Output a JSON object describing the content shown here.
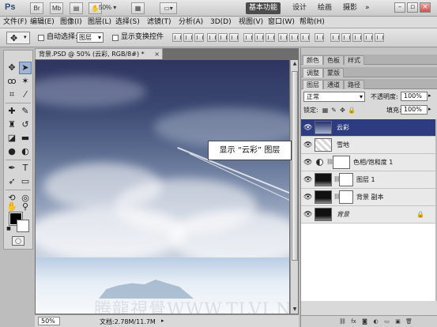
{
  "app": {
    "logo": "Ps",
    "zoom": "50%"
  },
  "topbar": {
    "buttons": [
      "Br",
      "Mb"
    ],
    "zoom_select": "50%",
    "workspaces": [
      {
        "label": "基本功能",
        "active": true
      },
      {
        "label": "设计",
        "active": false
      },
      {
        "label": "绘画",
        "active": false
      },
      {
        "label": "摄影",
        "active": false
      }
    ],
    "window_controls": {
      "minimize": "–",
      "restore": "▫",
      "close": "×"
    }
  },
  "menubar": {
    "items": [
      "文件(F)",
      "编辑(E)",
      "图像(I)",
      "图层(L)",
      "选择(S)",
      "滤镜(T)",
      "分析(A)",
      "3D(D)",
      "视图(V)",
      "窗口(W)",
      "帮助(H)"
    ]
  },
  "options": {
    "auto_select_label": "自动选择:",
    "auto_select_value": "图层",
    "show_transform_label": "显示变换控件"
  },
  "document": {
    "tab_title": "背景.PSD @ 50% (云彩, RGB/8#) *",
    "tab_close": "×",
    "status_zoom": "50%",
    "status_info": "文档:2.78M/11.7M",
    "watermark": "腾龍視覺WWW.TLVI.NET"
  },
  "callout": {
    "text": "显示 “云彩” 图层"
  },
  "panels": {
    "group1_tabs": [
      "颜色",
      "色板",
      "样式"
    ],
    "group2_tabs": [
      "调整",
      "蒙版"
    ],
    "group3_tabs": [
      "图层",
      "通道",
      "路径"
    ],
    "blend_mode": "正常",
    "opacity_label": "不透明度:",
    "opacity_value": "100%",
    "lock_label": "锁定:",
    "fill_label": "填充:",
    "fill_value": "100%"
  },
  "layers": [
    {
      "name": "云彩",
      "selected": true,
      "thumb": "cloud"
    },
    {
      "name": "雪地",
      "selected": false,
      "thumb": "snow"
    },
    {
      "name": "色相/饱和度 1",
      "selected": false,
      "thumb": "adjustment"
    },
    {
      "name": "图层 1",
      "selected": false,
      "thumb": "dark"
    },
    {
      "name": "背景 副本",
      "selected": false,
      "thumb": "dark"
    },
    {
      "name": "背景",
      "selected": false,
      "thumb": "dark",
      "locked": true
    }
  ],
  "icons": {
    "eye": "eye-icon",
    "lock": "lock-icon",
    "link": "link-icon"
  }
}
